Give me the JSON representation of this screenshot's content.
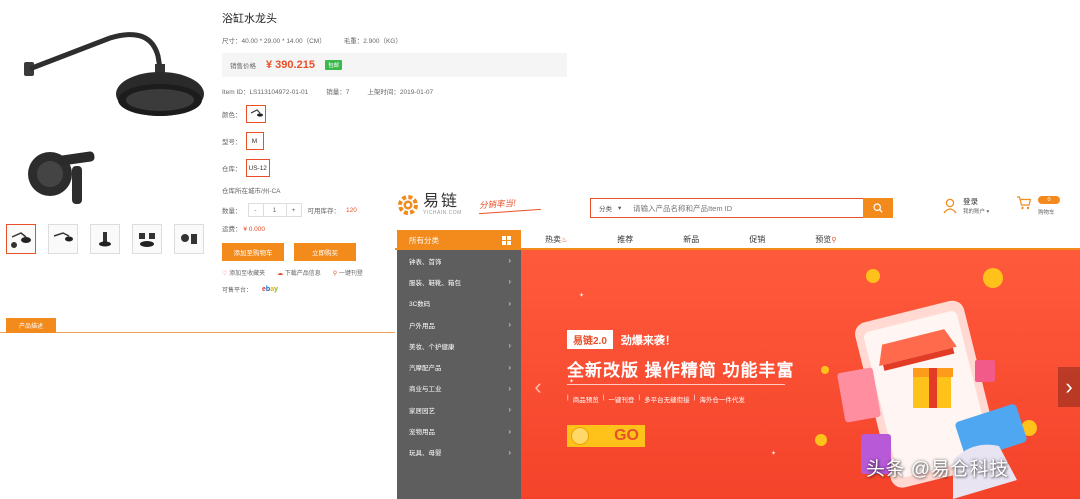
{
  "product": {
    "title": "浴缸水龙头",
    "size": "尺寸：40.00 * 29.00 * 14.00（CM）",
    "weight": "毛重：2.900（KG）",
    "price_label": "销售价格",
    "price": "¥ 390.215",
    "price_badge": "包邮",
    "item_id": "Item ID：LS113104972-01-01",
    "sales": "销量：7",
    "listed": "上架时间：2019-01-07",
    "color_label": "颜色：",
    "model_label": "型号：",
    "model_value": "M",
    "warehouse_label": "仓库：",
    "warehouse_value": "US-12",
    "warehouse_location": "仓库所在城市/州-CA",
    "qty_label": "数量：",
    "qty_minus": "-",
    "qty_value": "1",
    "qty_plus": "+",
    "stock_label": "可用库存：",
    "stock_value": "120",
    "freight_label": "运费：",
    "freight_value": "¥ 0.000",
    "add_cart_button": "添加至购物车",
    "buy_now_button": "立即购买",
    "link_favorite": "添加至收藏夹",
    "link_download": "下载产品信息",
    "link_onekey": "一键刊登",
    "platform_label": "可售平台：",
    "desc_tab": "产品描述"
  },
  "home": {
    "logo_name": "易链",
    "logo_sub": "YICHAIN.COM",
    "slogan": "分销率当!",
    "search": {
      "category": "分类",
      "placeholder": "请输入产品名称和产品Item ID"
    },
    "account": {
      "login": "登录",
      "my_account": "我的账户 ▾"
    },
    "cart": {
      "count": "0",
      "label": "购物车"
    },
    "all_categories": "所有分类",
    "nav": [
      "热卖",
      "推荐",
      "新品",
      "促销",
      "预览"
    ],
    "categories": [
      "钟表、首饰",
      "服装、鞋靴、箱包",
      "3C数码",
      "户外用品",
      "美妆、个护健康",
      "汽摩配产品",
      "商业与工业",
      "家居园艺",
      "宠物用品",
      "玩具、母婴"
    ],
    "banner": {
      "tag": "易链2.0",
      "tag_text": "劲爆来袭！",
      "headline": "全新改版 操作精简 功能丰富",
      "features": [
        "商品预览",
        "一键刊登",
        "多平台无缝衔接",
        "海外仓一件代发"
      ],
      "go": "GO"
    }
  },
  "watermark": "头条 @易仓科技",
  "colors": {
    "accent": "#f28a1c",
    "price": "#e8502a",
    "sidebar": "#5e5e5e",
    "banner": "#f4432a"
  }
}
